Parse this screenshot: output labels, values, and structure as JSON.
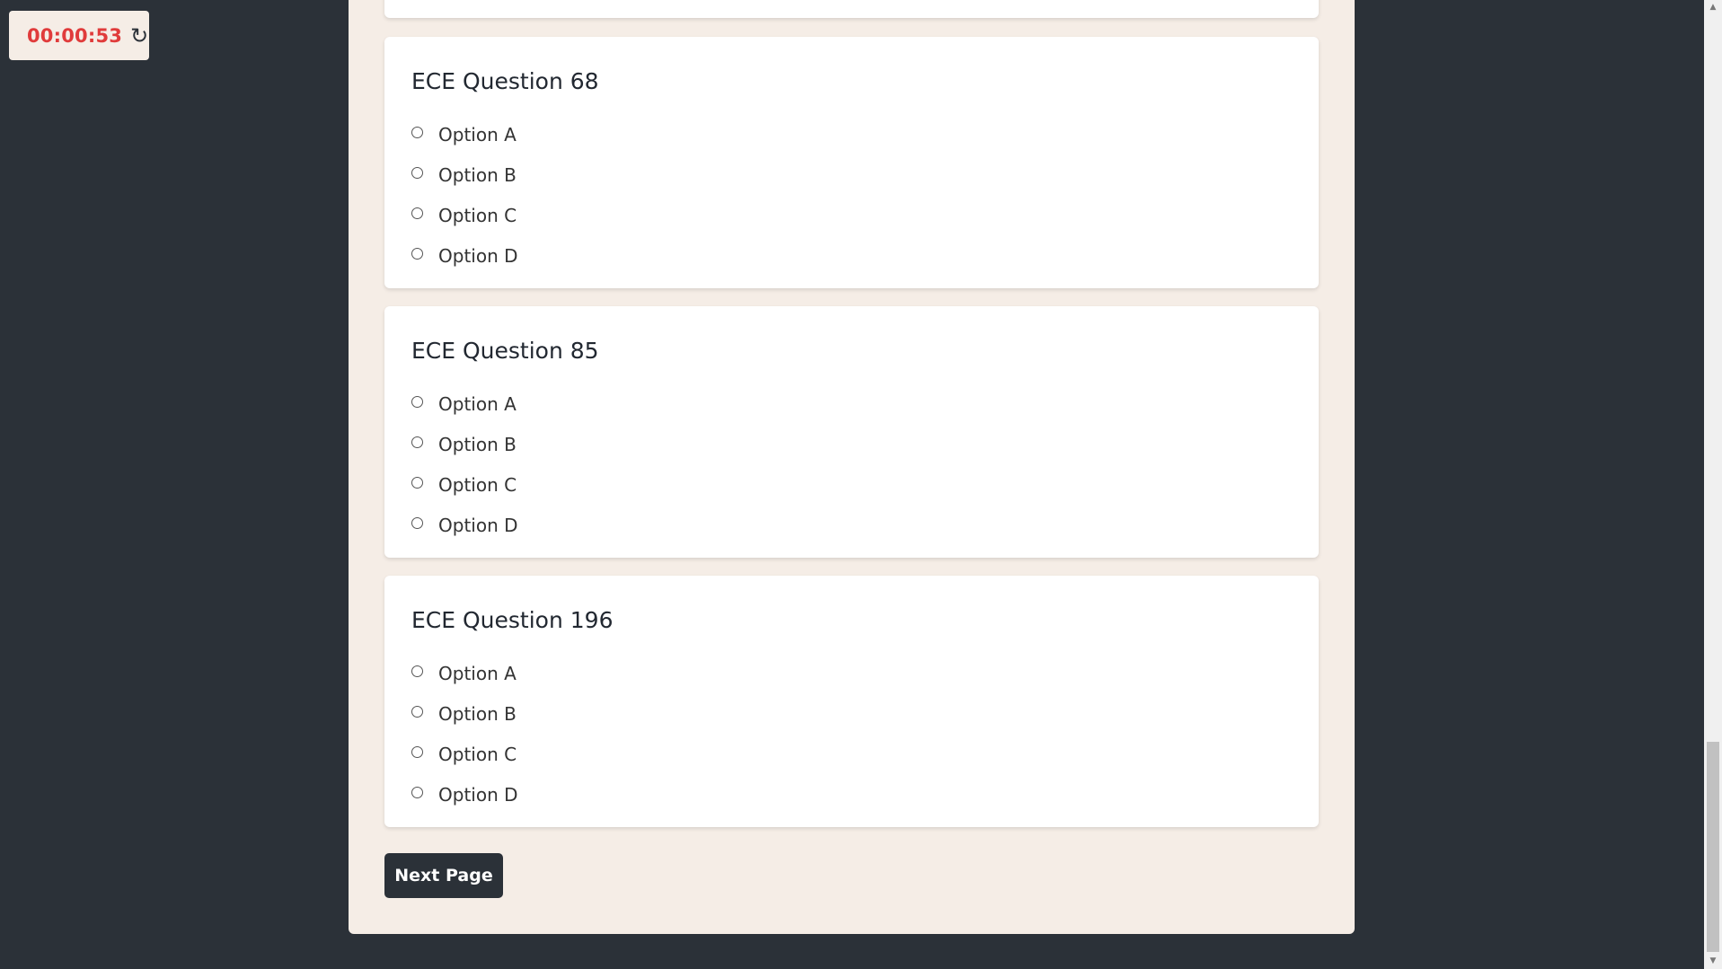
{
  "timer": {
    "value": "00:00:53",
    "reset_icon": "↻",
    "value_color": "#e03b3b"
  },
  "questions": [
    {
      "title": "ECE Question 68",
      "options": [
        "Option A",
        "Option B",
        "Option C",
        "Option D"
      ]
    },
    {
      "title": "ECE Question 85",
      "options": [
        "Option A",
        "Option B",
        "Option C",
        "Option D"
      ]
    },
    {
      "title": "ECE Question 196",
      "options": [
        "Option A",
        "Option B",
        "Option C",
        "Option D"
      ]
    }
  ],
  "navigation": {
    "next_label": "Next Page"
  },
  "scrollbar": {
    "up_icon": "▲",
    "down_icon": "▼"
  },
  "colors": {
    "background": "#2b3138",
    "panel": "#f5ede6",
    "card": "#ffffff",
    "button": "#2b3138"
  }
}
